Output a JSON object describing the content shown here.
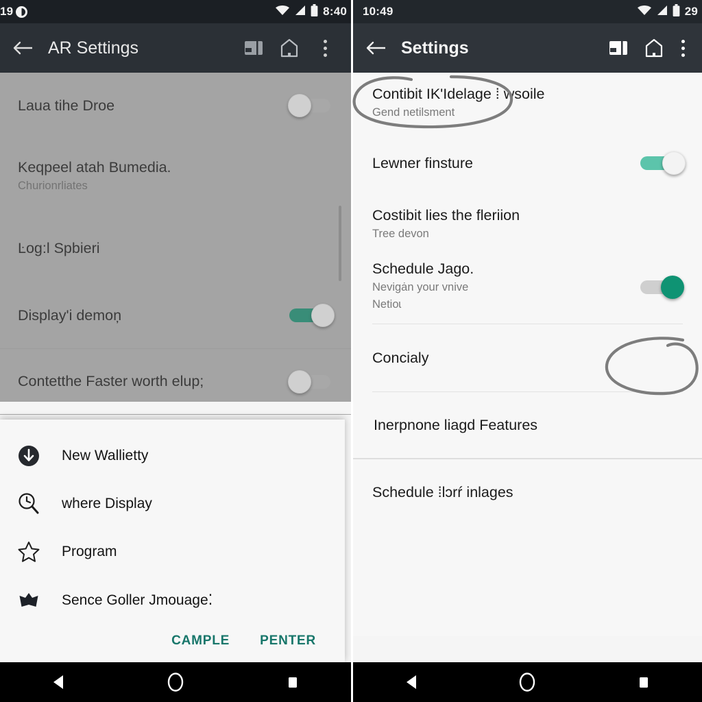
{
  "left_phone": {
    "status_bar": {
      "left_text": "19",
      "dnd_icon": "do-not-disturb-icon",
      "clock": "8:40",
      "wifi_icon": "wifi-icon",
      "signal_icon": "signal-icon",
      "battery_icon": "battery-icon"
    },
    "app_bar": {
      "back_icon": "arrow-back-icon",
      "title": "AR Settings",
      "cast_icon": "cast-icon",
      "home_icon": "home-outline-icon",
      "overflow_icon": "more-vertical-icon"
    },
    "settings": [
      {
        "title": "Laua tihe Droe",
        "subtitle": "",
        "toggle": "off"
      },
      {
        "title": "Keqpeel atah Bumedia.",
        "subtitle": "Churionrliates",
        "toggle": "none"
      },
      {
        "title": "Ŀog:l Spbieri",
        "subtitle": "",
        "toggle": "none"
      },
      {
        "title": "Display'i demoņ",
        "subtitle": "",
        "toggle": "on"
      },
      {
        "title": "Contetthe Faster worth elup;",
        "subtitle": "",
        "toggle": "off"
      }
    ],
    "dialog": {
      "items": [
        {
          "icon": "download-circle-icon",
          "label": "New Wallietty"
        },
        {
          "icon": "clock-search-icon",
          "label": "where Display"
        },
        {
          "icon": "star-outline-icon",
          "label": "Program"
        },
        {
          "icon": "star-filled-icon",
          "label": "Sence Goller Jmouage⁚"
        }
      ],
      "cancel_label": "CAMPLE",
      "confirm_label": "PENTER"
    },
    "nav_bar": {
      "back_icon": "nav-back-triangle-icon",
      "home_icon": "nav-home-circle-icon",
      "recents_icon": "nav-recents-square-icon"
    }
  },
  "right_phone": {
    "status_bar": {
      "clock": "10:49",
      "battery_text": "29",
      "wifi_icon": "wifi-icon",
      "signal_icon": "signal-icon",
      "battery_icon": "battery-icon"
    },
    "app_bar": {
      "back_icon": "arrow-back-icon",
      "title": "Settings",
      "cast_icon": "cast-icon",
      "home_icon": "home-outline-icon",
      "overflow_icon": "more-vertical-icon"
    },
    "settings": [
      {
        "title": "Contibit IK'Idelage ⁞ wsoile",
        "subtitle": "Gend netіlsment",
        "toggle": "none",
        "annotated": true
      },
      {
        "title": "Lewner finsture",
        "subtitle": "",
        "toggle": "on-lite"
      },
      {
        "title": "Costibit lies the fleriion",
        "subtitle": "Tree devon",
        "toggle": "none"
      },
      {
        "title": "Schedule Jago.",
        "subtitle": "Nevigȧn your vnive",
        "subtitle2": "Netioɩ",
        "toggle": "green-thumb"
      },
      {
        "title": "Concialy",
        "subtitle": "",
        "toggle": "none",
        "annotated": true
      },
      {
        "title": "Inerpnone liagd Features",
        "subtitle": "",
        "toggle": "none"
      },
      {
        "title": "Schedule ⁞lɔrŕ inlages",
        "subtitle": "",
        "toggle": "none"
      }
    ],
    "nav_bar": {
      "back_icon": "nav-back-triangle-icon",
      "home_icon": "nav-home-circle-icon",
      "recents_icon": "nav-recents-square-icon"
    }
  },
  "annotations": [
    {
      "name": "ellipse-highlight-top",
      "shape": "hand-drawn-ellipse"
    },
    {
      "name": "ellipse-highlight-toggle",
      "shape": "hand-drawn-circle"
    }
  ],
  "colors": {
    "status_bar_bg": "#1d2126",
    "app_bar_bg": "#2d3238",
    "accent_teal": "#17766a",
    "toggle_on": "#1a9274",
    "toggle_on_light": "#5cc4ab",
    "left_overlay": "#b4b4b4",
    "right_bg": "#f7f7f7",
    "annotation_stroke": "#7d7d7d"
  }
}
